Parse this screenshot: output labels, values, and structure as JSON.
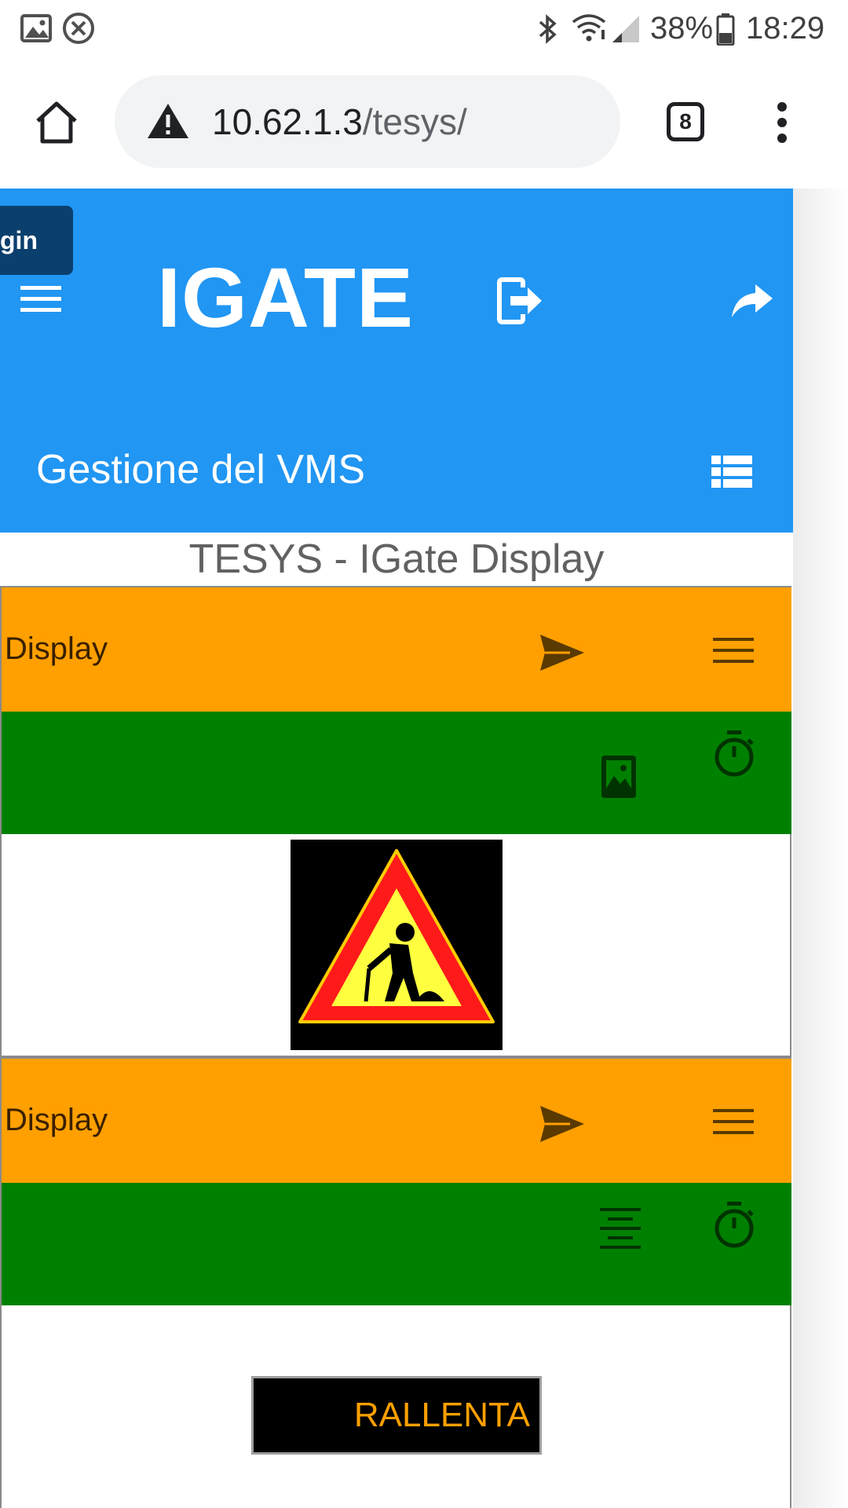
{
  "status_bar": {
    "battery": "38%",
    "time": "18:29"
  },
  "browser": {
    "url_host": "10.62.1.3",
    "url_path": "/tesys/",
    "tab_count": "8"
  },
  "app": {
    "login_label": "gin",
    "brand": "IGATE",
    "subtitle": "Gestione del VMS",
    "page_title": "TESYS - IGate Display"
  },
  "panels": [
    {
      "label": "Display",
      "content_icon": "image-icon",
      "sign": "roadworks-warning-sign"
    },
    {
      "label": "Display",
      "content_icon": "align-center-icon",
      "sign_text": "RALLENTA"
    }
  ],
  "colors": {
    "header_blue": "#2196f3",
    "login_dark": "#0b3f6e",
    "panel_orange": "#ffa000",
    "panel_green": "#008000",
    "sign_text": "#ffa000"
  }
}
